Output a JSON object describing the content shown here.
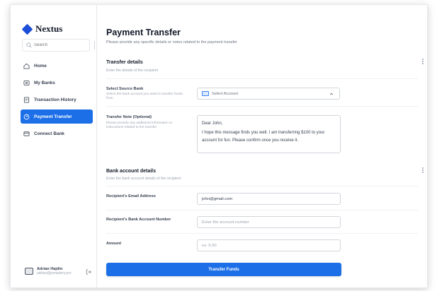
{
  "app": {
    "name": "Nextus"
  },
  "sidebar": {
    "search_placeholder": "Search",
    "items": [
      {
        "label": "Home",
        "icon": "home-icon",
        "active": false
      },
      {
        "label": "My Banks",
        "icon": "bank-icon",
        "active": false
      },
      {
        "label": "Transaction History",
        "icon": "history-icon",
        "active": false
      },
      {
        "label": "Payment Transfer",
        "icon": "transfer-icon",
        "active": true
      },
      {
        "label": "Connect Bank",
        "icon": "connect-icon",
        "active": false
      }
    ],
    "user": {
      "name": "Adrian Hajdin",
      "email": "adrian@jsmastery.pro"
    }
  },
  "header": {
    "title": "Payment Transfer",
    "subtitle": "Please provide any specific details or notes related to the payment transfer"
  },
  "transfer_details": {
    "title": "Transfer details",
    "subtitle": "Enter the details of the recipient",
    "source_bank": {
      "label": "Select Source Bank",
      "help": "Select the bank account you want to transfer funds from",
      "value": "Select Account"
    },
    "note": {
      "label": "Transfer Note (Optional)",
      "help": "Please provide any additional information or instructions related to the transfer",
      "greeting": "Dear John,",
      "body": "I hope this message finds you well. I am transferring $100 to your account for fun. Please confirm once you receive it."
    }
  },
  "bank_details": {
    "title": "Bank account details",
    "subtitle": "Enter the bank account details of the recipient",
    "email": {
      "label": "Recipient's Email Address",
      "value": "john@gmail.com"
    },
    "account_number": {
      "label": "Recipient's Bank Account Number",
      "placeholder": "Enter the account number"
    },
    "amount": {
      "label": "Amount",
      "placeholder": "ex: 5.00"
    }
  },
  "submit_label": "Transfer Funds",
  "colors": {
    "accent": "#1d6fe8",
    "logo": "#1d4ed8"
  }
}
